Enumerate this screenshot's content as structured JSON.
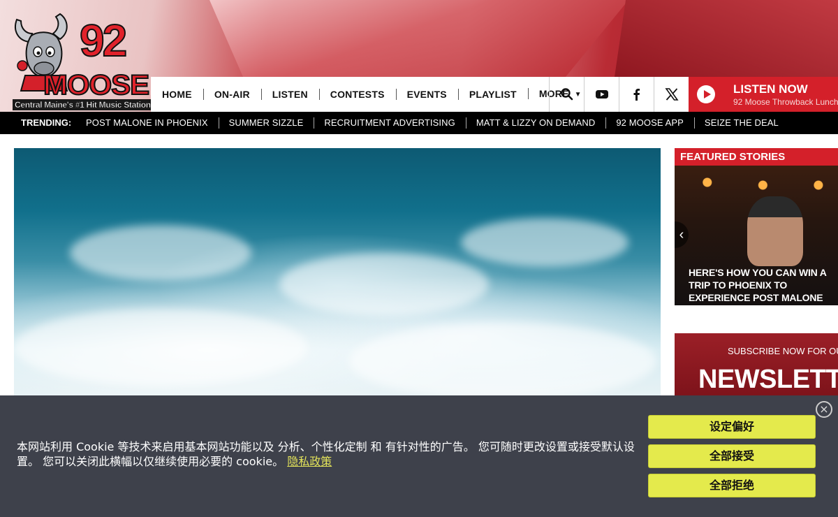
{
  "logo": {
    "number": "92",
    "word": "MOOSE",
    "tagline": "Central Maine's #1 Hit Music Station"
  },
  "nav": {
    "items": [
      {
        "label": "HOME"
      },
      {
        "label": "ON-AIR"
      },
      {
        "label": "LISTEN"
      },
      {
        "label": "CONTESTS"
      },
      {
        "label": "EVENTS"
      },
      {
        "label": "PLAYLIST"
      },
      {
        "label": "MORE"
      }
    ],
    "icons": [
      "search-icon",
      "youtube-icon",
      "facebook-icon",
      "x-icon"
    ]
  },
  "listen_now": {
    "title": "LISTEN NOW",
    "subtitle": "92 Moose Throwback Lunch"
  },
  "trending": {
    "label": "TRENDING:",
    "items": [
      "POST MALONE IN PHOENIX",
      "SUMMER SIZZLE",
      "RECRUITMENT ADVERTISING",
      "MATT & LIZZY ON DEMAND",
      "92 MOOSE APP",
      "SEIZE THE DEAL"
    ]
  },
  "featured": {
    "heading": "FEATURED STORIES",
    "story_title": "HERE'S HOW YOU CAN WIN A TRIP TO PHOENIX TO EXPERIENCE POST MALONE"
  },
  "newsletter": {
    "subtitle": "SUBSCRIBE NOW FOR OUR",
    "title": "NEWSLETTER"
  },
  "cookie": {
    "text": "本网站利用 Cookie 等技术来启用基本网站功能以及 分析、个性化定制 和 有针对性的广告。 您可随时更改设置或接受默认设置。 您可以关闭此横幅以仅继续使用必要的 cookie。",
    "privacy_link": "隐私政策",
    "buttons": {
      "preferences": "设定偏好",
      "accept_all": "全部接受",
      "reject_all": "全部拒绝"
    },
    "close_symbol": "×"
  },
  "colors": {
    "brand_red": "#d4202a",
    "cookie_bg": "#3e414b",
    "cookie_button": "#e4ea4c"
  }
}
